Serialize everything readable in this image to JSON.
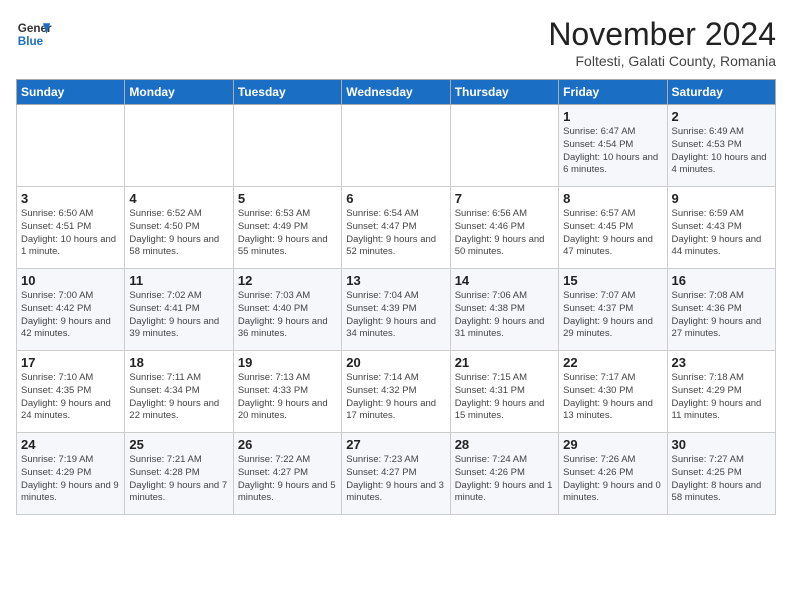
{
  "header": {
    "logo_line1": "General",
    "logo_line2": "Blue",
    "month": "November 2024",
    "location": "Foltesti, Galati County, Romania"
  },
  "days_of_week": [
    "Sunday",
    "Monday",
    "Tuesday",
    "Wednesday",
    "Thursday",
    "Friday",
    "Saturday"
  ],
  "weeks": [
    [
      {
        "day": "",
        "info": ""
      },
      {
        "day": "",
        "info": ""
      },
      {
        "day": "",
        "info": ""
      },
      {
        "day": "",
        "info": ""
      },
      {
        "day": "",
        "info": ""
      },
      {
        "day": "1",
        "info": "Sunrise: 6:47 AM\nSunset: 4:54 PM\nDaylight: 10 hours and 6 minutes."
      },
      {
        "day": "2",
        "info": "Sunrise: 6:49 AM\nSunset: 4:53 PM\nDaylight: 10 hours and 4 minutes."
      }
    ],
    [
      {
        "day": "3",
        "info": "Sunrise: 6:50 AM\nSunset: 4:51 PM\nDaylight: 10 hours and 1 minute."
      },
      {
        "day": "4",
        "info": "Sunrise: 6:52 AM\nSunset: 4:50 PM\nDaylight: 9 hours and 58 minutes."
      },
      {
        "day": "5",
        "info": "Sunrise: 6:53 AM\nSunset: 4:49 PM\nDaylight: 9 hours and 55 minutes."
      },
      {
        "day": "6",
        "info": "Sunrise: 6:54 AM\nSunset: 4:47 PM\nDaylight: 9 hours and 52 minutes."
      },
      {
        "day": "7",
        "info": "Sunrise: 6:56 AM\nSunset: 4:46 PM\nDaylight: 9 hours and 50 minutes."
      },
      {
        "day": "8",
        "info": "Sunrise: 6:57 AM\nSunset: 4:45 PM\nDaylight: 9 hours and 47 minutes."
      },
      {
        "day": "9",
        "info": "Sunrise: 6:59 AM\nSunset: 4:43 PM\nDaylight: 9 hours and 44 minutes."
      }
    ],
    [
      {
        "day": "10",
        "info": "Sunrise: 7:00 AM\nSunset: 4:42 PM\nDaylight: 9 hours and 42 minutes."
      },
      {
        "day": "11",
        "info": "Sunrise: 7:02 AM\nSunset: 4:41 PM\nDaylight: 9 hours and 39 minutes."
      },
      {
        "day": "12",
        "info": "Sunrise: 7:03 AM\nSunset: 4:40 PM\nDaylight: 9 hours and 36 minutes."
      },
      {
        "day": "13",
        "info": "Sunrise: 7:04 AM\nSunset: 4:39 PM\nDaylight: 9 hours and 34 minutes."
      },
      {
        "day": "14",
        "info": "Sunrise: 7:06 AM\nSunset: 4:38 PM\nDaylight: 9 hours and 31 minutes."
      },
      {
        "day": "15",
        "info": "Sunrise: 7:07 AM\nSunset: 4:37 PM\nDaylight: 9 hours and 29 minutes."
      },
      {
        "day": "16",
        "info": "Sunrise: 7:08 AM\nSunset: 4:36 PM\nDaylight: 9 hours and 27 minutes."
      }
    ],
    [
      {
        "day": "17",
        "info": "Sunrise: 7:10 AM\nSunset: 4:35 PM\nDaylight: 9 hours and 24 minutes."
      },
      {
        "day": "18",
        "info": "Sunrise: 7:11 AM\nSunset: 4:34 PM\nDaylight: 9 hours and 22 minutes."
      },
      {
        "day": "19",
        "info": "Sunrise: 7:13 AM\nSunset: 4:33 PM\nDaylight: 9 hours and 20 minutes."
      },
      {
        "day": "20",
        "info": "Sunrise: 7:14 AM\nSunset: 4:32 PM\nDaylight: 9 hours and 17 minutes."
      },
      {
        "day": "21",
        "info": "Sunrise: 7:15 AM\nSunset: 4:31 PM\nDaylight: 9 hours and 15 minutes."
      },
      {
        "day": "22",
        "info": "Sunrise: 7:17 AM\nSunset: 4:30 PM\nDaylight: 9 hours and 13 minutes."
      },
      {
        "day": "23",
        "info": "Sunrise: 7:18 AM\nSunset: 4:29 PM\nDaylight: 9 hours and 11 minutes."
      }
    ],
    [
      {
        "day": "24",
        "info": "Sunrise: 7:19 AM\nSunset: 4:29 PM\nDaylight: 9 hours and 9 minutes."
      },
      {
        "day": "25",
        "info": "Sunrise: 7:21 AM\nSunset: 4:28 PM\nDaylight: 9 hours and 7 minutes."
      },
      {
        "day": "26",
        "info": "Sunrise: 7:22 AM\nSunset: 4:27 PM\nDaylight: 9 hours and 5 minutes."
      },
      {
        "day": "27",
        "info": "Sunrise: 7:23 AM\nSunset: 4:27 PM\nDaylight: 9 hours and 3 minutes."
      },
      {
        "day": "28",
        "info": "Sunrise: 7:24 AM\nSunset: 4:26 PM\nDaylight: 9 hours and 1 minute."
      },
      {
        "day": "29",
        "info": "Sunrise: 7:26 AM\nSunset: 4:26 PM\nDaylight: 9 hours and 0 minutes."
      },
      {
        "day": "30",
        "info": "Sunrise: 7:27 AM\nSunset: 4:25 PM\nDaylight: 8 hours and 58 minutes."
      }
    ]
  ]
}
